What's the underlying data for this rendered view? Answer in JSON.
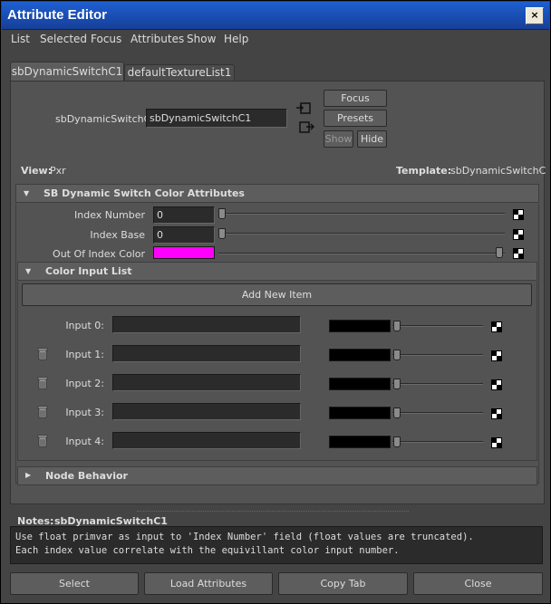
{
  "window": {
    "title": "Attribute Editor",
    "close_label": "×"
  },
  "menu": [
    "List",
    "Selected",
    "Focus",
    "Attributes",
    "Show",
    "Help"
  ],
  "tabs": [
    "sbDynamicSwitchC1",
    "defaultTextureList1"
  ],
  "node": {
    "label": "sbDynamicSwitchC:",
    "value": "sbDynamicSwitchC1"
  },
  "buttons": {
    "focus": "Focus",
    "presets": "Presets",
    "show": "Show",
    "hide": "Hide"
  },
  "view": {
    "label": "View:",
    "value": "Pxr"
  },
  "template": {
    "label": "Template:",
    "value": "sbDynamicSwitchC"
  },
  "section_color_attrs": {
    "title": "SB Dynamic Switch Color Attributes",
    "index_number": {
      "label": "Index Number",
      "value": "0"
    },
    "index_base": {
      "label": "Index Base",
      "value": "0"
    },
    "out_of_index_color": {
      "label": "Out Of Index Color",
      "color": "#ff00ff"
    }
  },
  "section_color_input_list": {
    "title": "Color Input List",
    "add_button": "Add New Item",
    "inputs": [
      {
        "label": "Input 0:",
        "value": "",
        "color": "#000000",
        "deletable": false
      },
      {
        "label": "Input 1:",
        "value": "",
        "color": "#000000",
        "deletable": true
      },
      {
        "label": "Input 2:",
        "value": "",
        "color": "#000000",
        "deletable": true
      },
      {
        "label": "Input 3:",
        "value": "",
        "color": "#000000",
        "deletable": true
      },
      {
        "label": "Input 4:",
        "value": "",
        "color": "#000000",
        "deletable": true
      }
    ]
  },
  "section_node_behavior": {
    "title": "Node Behavior"
  },
  "notes": {
    "label": "Notes:",
    "node": "sbDynamicSwitchC1",
    "line1": "Use float primvar as input to 'Index Number' field (float values are truncated).",
    "line2": "Each index value correlate with the equivillant color input number."
  },
  "bottom_buttons": [
    "Select",
    "Load Attributes",
    "Copy Tab",
    "Close"
  ]
}
